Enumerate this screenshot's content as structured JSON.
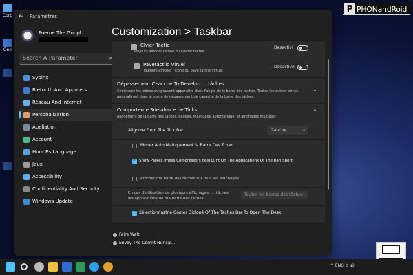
{
  "desktop": {
    "icons": [
      {
        "label": "Corb",
        "color": "#5fa8e8"
      },
      {
        "label": "One",
        "color": "#3b7bd1"
      },
      {
        "label": "",
        "color": "#2a4a8a"
      }
    ]
  },
  "watermark": {
    "letter": "P",
    "text": "PHONandRoid"
  },
  "window": {
    "back_icon": "←",
    "app_title": "Paramètres",
    "user": {
      "name": "Poeme The Goupl"
    },
    "search": {
      "placeholder": "Search A Parameter",
      "icon": "search-icon"
    },
    "nav": [
      {
        "label": "Syolnx",
        "color": "#4a90e2"
      },
      {
        "label": "Bletooth And Apporets",
        "color": "#3a7bd5"
      },
      {
        "label": "Réseau And Internet",
        "color": "#6ab0f0"
      },
      {
        "label": "Personalization",
        "color": "#e0a060",
        "active": true
      },
      {
        "label": "Apeliation",
        "color": "#7a8aa0"
      },
      {
        "label": "Account",
        "color": "#48c080"
      },
      {
        "label": "Hour Es Language",
        "color": "#5aa0e0"
      },
      {
        "label": "Jeux",
        "color": "#9a9a9a"
      },
      {
        "label": "Accessibility",
        "color": "#5ab0f0"
      },
      {
        "label": "Confidentiality And Security",
        "color": "#888888"
      },
      {
        "label": "Windows Update",
        "color": "#3a8ad0"
      }
    ],
    "page_title": "Customization > Taskbar",
    "top_rows": [
      {
        "title": "Clvier Tactio",
        "desc": "Toujours afficher l'icône du clavier tactile",
        "toggle_label": "Desactivi"
      },
      {
        "title": "Pavetactilo Viruel",
        "desc": "Toujours afficher l'icône du pavé tactile virtuel",
        "toggle_label": "Désactivé"
      }
    ],
    "overflow_section": {
      "title": "Dépassement Ceacche To Develop ... tâches",
      "desc1": "Choisissez les icônes qui peuvent apparaître dans l'angle de la barre des tâches. Toutes les autres icônes",
      "desc2": "apparaîtront dans le menu de dépassement de capacité de la barre des tâches."
    },
    "behavior_section": {
      "title": "Comporteme  Sdelahar e de Ticks",
      "desc": "Alignement de la barre des tâches, badges, masquage automatique, et affichages multiples",
      "alignment_label": "Alignme  From The Tick Bar",
      "alignment_value": "Gauche",
      "options": [
        {
          "label": "Mnner Auto Mattquement la Barre Des Tchen",
          "checked": false
        },
        {
          "label": "Show Parkes Imess Comoressors gelo Lunt On The Applications Of The Ban Sport",
          "checked": true
        },
        {
          "label": "Afficher ma barre des tâches sur tous les affichages",
          "checked": false
        }
      ],
      "multi_label1": "En cas d'utilisation de plusieurs affichages, ... tâches",
      "multi_label2": "les applications de ma barre des tâches",
      "multi_value": "Toutes les barres des tâches",
      "corner_option": {
        "label": "Sélectionnaztne Comer Dicloné Of The Taches Bar To Open The Desk",
        "checked": true
      }
    },
    "links": [
      {
        "label": "Faire Walt"
      },
      {
        "label": "Envoy The Comnt Nuncal..."
      }
    ]
  },
  "taskbar": {
    "icons": [
      {
        "name": "start-icon",
        "color": "#4cc2ff"
      },
      {
        "name": "search-icon",
        "color": "#dddddd"
      },
      {
        "name": "settings-icon",
        "color": "#bbbbbb"
      },
      {
        "name": "file-explorer-icon",
        "color": "#f0c040"
      },
      {
        "name": "word-icon",
        "color": "#2b6cd4"
      },
      {
        "name": "excel-icon",
        "color": "#2a9a5a"
      },
      {
        "name": "skype-icon",
        "color": "#2aa0e8"
      },
      {
        "name": "chrome-icon",
        "color": "#e0a030"
      }
    ],
    "tray_text": "^ ENG ⇪ 🔊"
  }
}
